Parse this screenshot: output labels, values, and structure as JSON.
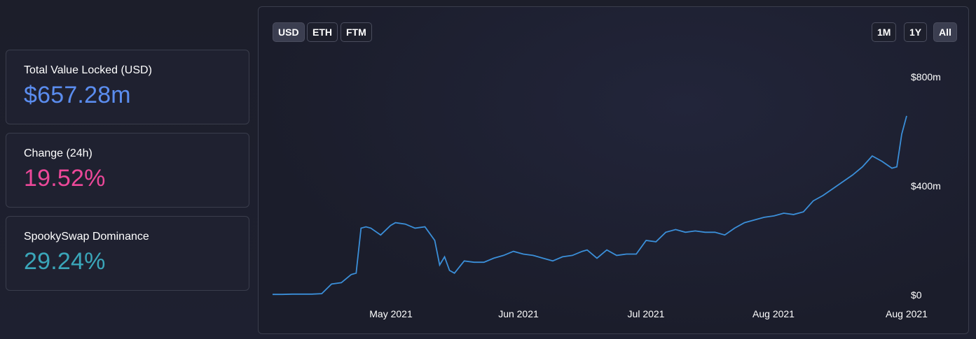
{
  "stats": [
    {
      "label": "Total Value Locked (USD)",
      "value": "$657.28m",
      "color": "#5b8def"
    },
    {
      "label": "Change (24h)",
      "value": "19.52%",
      "color": "#ec4899"
    },
    {
      "label": "SpookySwap Dominance",
      "value": "29.24%",
      "color": "#3aa6b9"
    }
  ],
  "currency_buttons": [
    {
      "label": "USD",
      "active": true
    },
    {
      "label": "ETH",
      "active": false
    },
    {
      "label": "FTM",
      "active": false
    }
  ],
  "range_buttons": [
    {
      "label": "1M",
      "active": false
    },
    {
      "label": "1Y",
      "active": false
    },
    {
      "label": "All",
      "active": true
    }
  ],
  "chart_data": {
    "type": "line",
    "series": [
      {
        "color": "#3b8fd9",
        "values": [
          [
            "2021-04-15",
            2
          ],
          [
            "2021-04-17",
            2
          ],
          [
            "2021-04-19",
            3
          ],
          [
            "2021-04-21",
            3
          ],
          [
            "2021-04-23",
            3
          ],
          [
            "2021-04-25",
            5
          ],
          [
            "2021-04-27",
            40
          ],
          [
            "2021-04-29",
            45
          ],
          [
            "2021-05-01",
            75
          ],
          [
            "2021-05-02",
            80
          ],
          [
            "2021-05-03",
            245
          ],
          [
            "2021-05-04",
            250
          ],
          [
            "2021-05-05",
            245
          ],
          [
            "2021-05-07",
            220
          ],
          [
            "2021-05-09",
            255
          ],
          [
            "2021-05-10",
            265
          ],
          [
            "2021-05-12",
            260
          ],
          [
            "2021-05-14",
            245
          ],
          [
            "2021-05-16",
            250
          ],
          [
            "2021-05-18",
            200
          ],
          [
            "2021-05-19",
            110
          ],
          [
            "2021-05-20",
            140
          ],
          [
            "2021-05-21",
            90
          ],
          [
            "2021-05-22",
            80
          ],
          [
            "2021-05-24",
            125
          ],
          [
            "2021-05-26",
            120
          ],
          [
            "2021-05-28",
            120
          ],
          [
            "2021-05-30",
            135
          ],
          [
            "2021-06-01",
            145
          ],
          [
            "2021-06-03",
            160
          ],
          [
            "2021-06-05",
            150
          ],
          [
            "2021-06-07",
            145
          ],
          [
            "2021-06-09",
            135
          ],
          [
            "2021-06-11",
            125
          ],
          [
            "2021-06-13",
            140
          ],
          [
            "2021-06-15",
            145
          ],
          [
            "2021-06-17",
            160
          ],
          [
            "2021-06-18",
            165
          ],
          [
            "2021-06-20",
            135
          ],
          [
            "2021-06-22",
            165
          ],
          [
            "2021-06-24",
            145
          ],
          [
            "2021-06-26",
            150
          ],
          [
            "2021-06-28",
            150
          ],
          [
            "2021-06-30",
            200
          ],
          [
            "2021-07-02",
            195
          ],
          [
            "2021-07-04",
            230
          ],
          [
            "2021-07-06",
            240
          ],
          [
            "2021-07-08",
            230
          ],
          [
            "2021-07-10",
            235
          ],
          [
            "2021-07-12",
            230
          ],
          [
            "2021-07-14",
            230
          ],
          [
            "2021-07-16",
            220
          ],
          [
            "2021-07-18",
            245
          ],
          [
            "2021-07-20",
            265
          ],
          [
            "2021-07-22",
            275
          ],
          [
            "2021-07-24",
            285
          ],
          [
            "2021-07-26",
            290
          ],
          [
            "2021-07-28",
            300
          ],
          [
            "2021-07-30",
            295
          ],
          [
            "2021-08-01",
            305
          ],
          [
            "2021-08-03",
            345
          ],
          [
            "2021-08-05",
            365
          ],
          [
            "2021-08-07",
            390
          ],
          [
            "2021-08-09",
            415
          ],
          [
            "2021-08-11",
            440
          ],
          [
            "2021-08-13",
            470
          ],
          [
            "2021-08-15",
            510
          ],
          [
            "2021-08-17",
            490
          ],
          [
            "2021-08-19",
            465
          ],
          [
            "2021-08-20",
            470
          ],
          [
            "2021-08-21",
            590
          ],
          [
            "2021-08-22",
            657
          ]
        ]
      }
    ],
    "x_ticks": [
      "May 2021",
      "Jun 2021",
      "Jul 2021",
      "Aug 2021",
      "Aug 2021"
    ],
    "y_ticks": [
      "$800m",
      "$400m",
      "$0"
    ],
    "ylim": [
      0,
      800
    ],
    "xlabel": "",
    "ylabel": "",
    "grid": false
  }
}
